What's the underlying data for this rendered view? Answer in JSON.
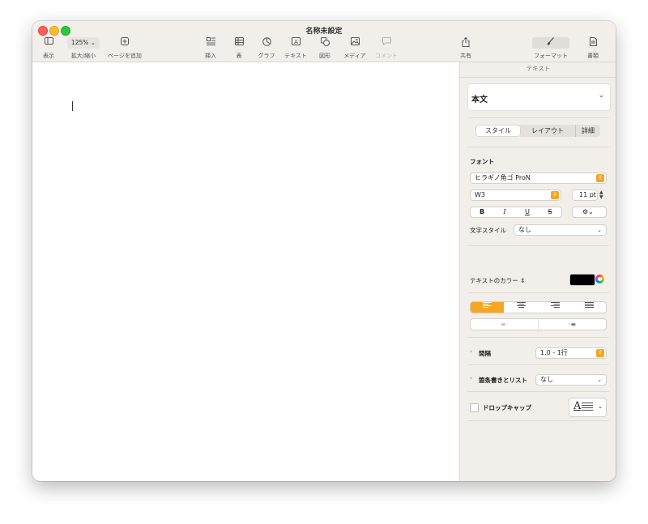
{
  "window": {
    "title": "名称未設定"
  },
  "toolbar": {
    "view": {
      "label": "表示",
      "icon": "sidebar-icon"
    },
    "zoom": {
      "value": "125%",
      "label": "拡大/縮小"
    },
    "add_page": {
      "label": "ページを追加",
      "icon": "add-page-icon"
    },
    "insert": {
      "label": "挿入",
      "icon": "insert-icon"
    },
    "table": {
      "label": "表",
      "icon": "table-icon"
    },
    "chart": {
      "label": "グラフ",
      "icon": "chart-icon"
    },
    "text": {
      "label": "テキスト",
      "icon": "textbox-icon"
    },
    "shape": {
      "label": "図形",
      "icon": "shape-icon"
    },
    "media": {
      "label": "メディア",
      "icon": "media-icon"
    },
    "comment": {
      "label": "コメント",
      "icon": "comment-icon"
    },
    "share": {
      "label": "共有",
      "icon": "share-icon"
    },
    "format": {
      "label": "フォーマット",
      "icon": "paintbrush-icon"
    },
    "document": {
      "label": "書類",
      "icon": "document-icon"
    }
  },
  "sidebar": {
    "header": "テキスト",
    "paragraph_style": "本文",
    "tabs": [
      "スタイル",
      "レイアウト",
      "詳細"
    ],
    "font": {
      "heading": "フォント",
      "family": "ヒラギノ角ゴ ProN",
      "weight": "W3",
      "size": "11 pt",
      "bold": "B",
      "italic": "I",
      "underline": "U",
      "strike": "S"
    },
    "char_style": {
      "label": "文字スタイル",
      "value": "なし"
    },
    "text_color": {
      "label": "テキストのカラー",
      "value": "#000000"
    },
    "spacing": {
      "label": "間隔",
      "value": "1.0 - 1行"
    },
    "bullets": {
      "label": "箇条書きとリスト",
      "value": "なし"
    },
    "dropcap": {
      "label": "ドロップキャップ",
      "glyph": "A"
    }
  },
  "colors": {
    "accent": "#f6a623",
    "sidebar_bg": "#f2eeea"
  }
}
